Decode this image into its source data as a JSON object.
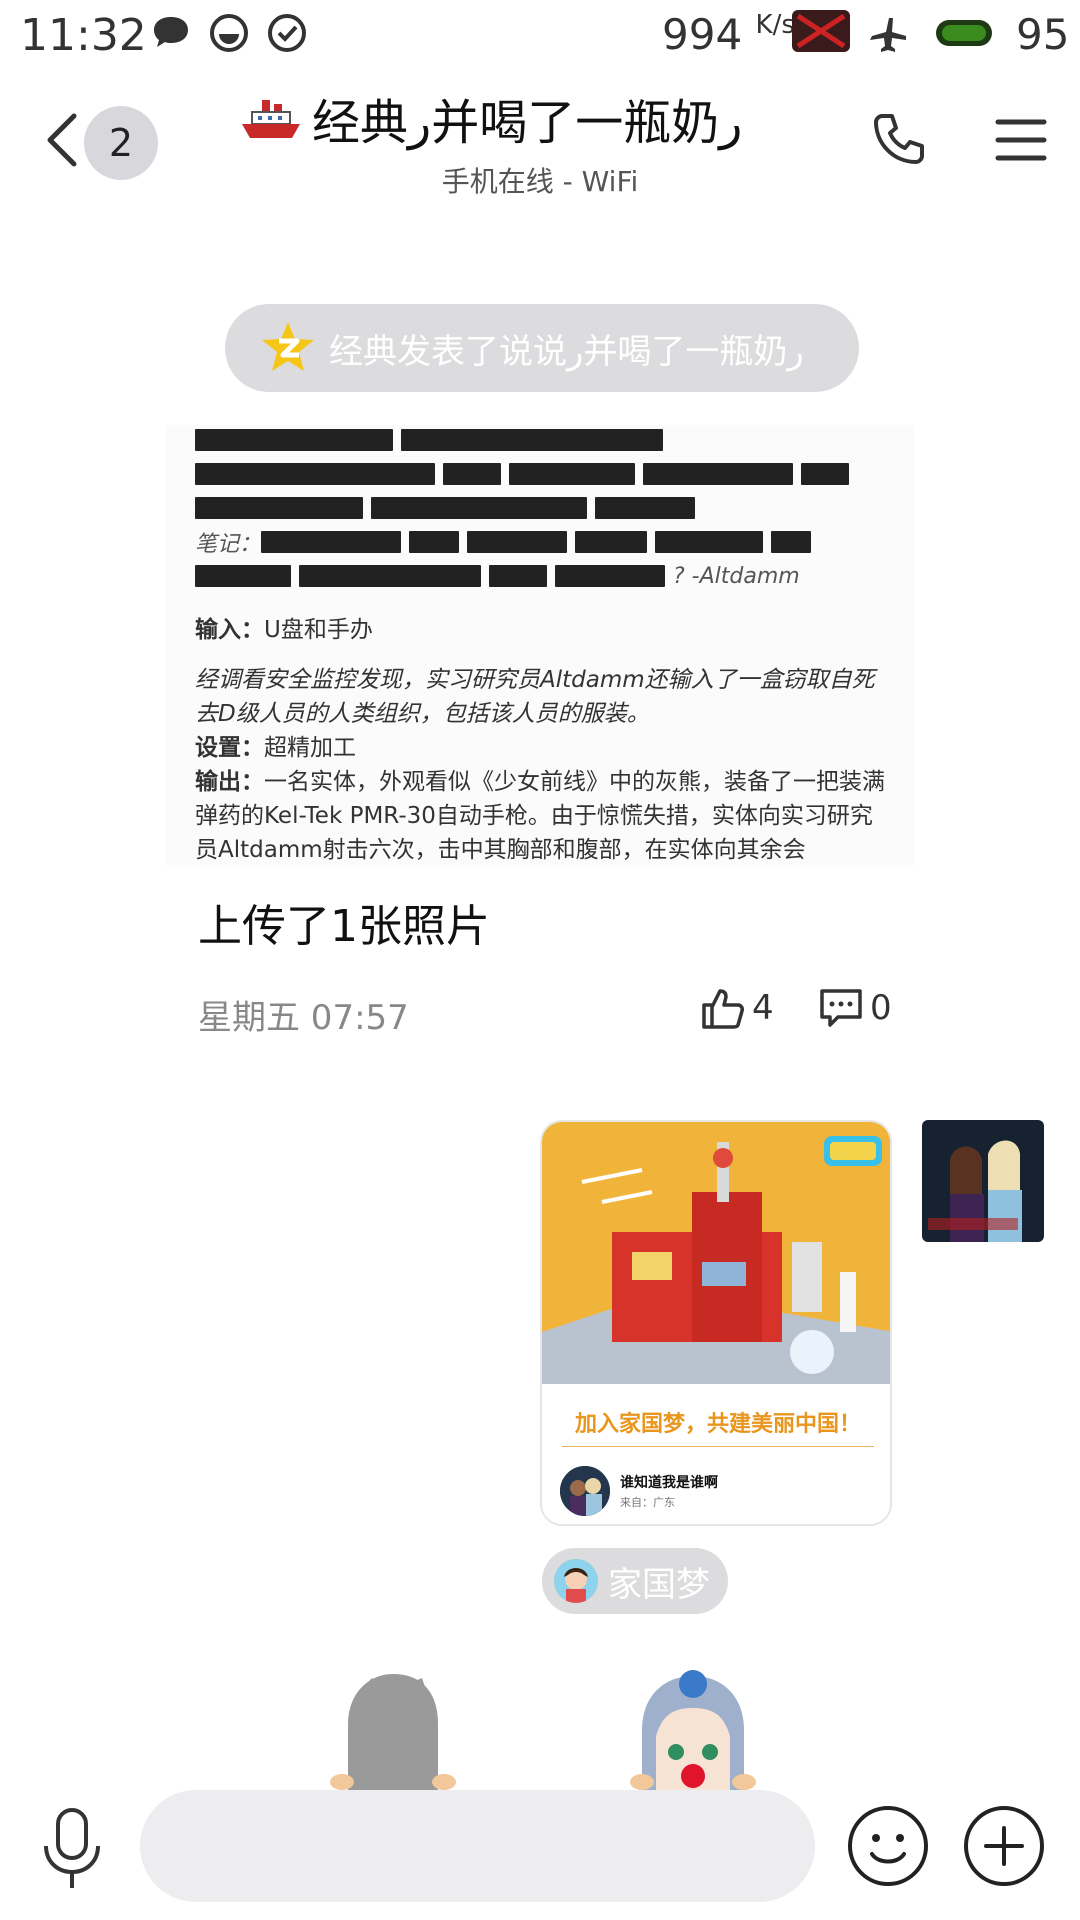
{
  "status_bar": {
    "time": "11:32",
    "net_speed": "994",
    "net_unit": "K/s",
    "battery": "95"
  },
  "header": {
    "unread_count": "2",
    "title": "经典ر并喝了一瓶奶ر",
    "subtitle": "手机在线 - WiFi"
  },
  "system_notice": "经典发表了说说ر并喝了一瓶奶ر",
  "post": {
    "note_label": "笔记：",
    "note_suffix": "? -Altdamm",
    "input_label": "输入：",
    "input_value": "U盘和手办",
    "italic_para": "经调看安全监控发现，实习研究员Altdamm还输入了一盒窃取自死去D级人员的人类组织，包括该人员的服装。",
    "setting_label": "设置：",
    "setting_value": "超精加工",
    "output_label": "输出：",
    "output_value": "一名实体，外观看似《少女前线》中的灰熊，装备了一把装满弹药的Kel-Tek PMR-30自动手枪。由于惊慌失措，实体向实习研究员Altdamm射击六次，击中其胸部和腹部，在实体向其余会",
    "caption": "上传了1张照片",
    "timestamp": "星期五 07:57",
    "likes": "4",
    "comments": "0"
  },
  "share_card": {
    "title": "加入家国梦，共建美丽中国！",
    "user_name": "谁知道我是谁啊",
    "from": "来自：广东"
  },
  "app_tag": "家国梦",
  "input_bar": {
    "placeholder": ""
  }
}
